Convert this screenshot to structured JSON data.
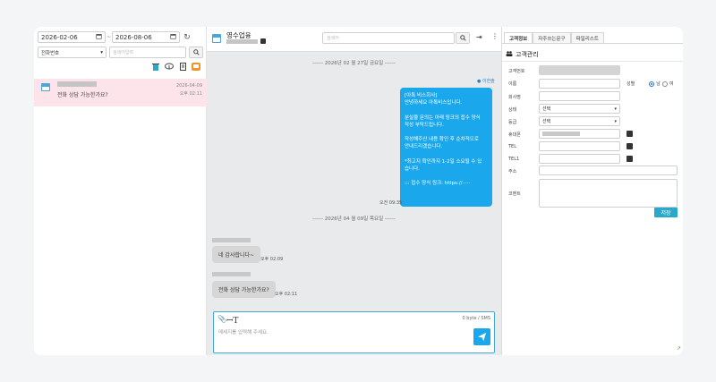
{
  "filters": {
    "start_date": "2026-02-06",
    "end_date": "2026-08-06",
    "separator": "~",
    "search_type": "전화번호",
    "search_placeholder": "검색어입력"
  },
  "chat_list": [
    {
      "preview": "전화 상담 가능한가요?",
      "date": "2026-04-09",
      "time": "오후 02:11"
    }
  ],
  "conversation": {
    "title": "영수업융",
    "search_placeholder": "검색어",
    "date_divider_1": "------ 2026년 02 월 27일 금요일 ------",
    "date_divider_2": "------ 2026년 04 월 09일 목요일 ------",
    "my_name": "이한솔",
    "my_message_lines": [
      "[아톡 비스회사]",
      "안녕하세요 아톡비스입니다.",
      "",
      "분실물 문의는 아래 링크의 접수 양식",
      "작성 부탁드립니다.",
      "",
      "작성해주신 내용 확인 후 순차적으로",
      "안내드리겠습니다.",
      "",
      "*최고지 확인까지 1-2일 소요될 수 있",
      "습니다.",
      "",
      "::: 접수 양식 링크: https://·····"
    ],
    "my_message_time": "오전 09:35",
    "incoming": [
      {
        "text": "네 감사합니다~",
        "time": "오후 02:09"
      },
      {
        "text": "전화 상담 가능한가요?",
        "time": "오후 02:11"
      }
    ],
    "compose_placeholder": "메세지를 입력해 주세요.",
    "byte_counter": "0 byte / SMS"
  },
  "right_panel": {
    "tabs": [
      "고객정보",
      "자주쓰는문구",
      "파일리스트"
    ],
    "panel_title": "고객관리",
    "fields": {
      "customer_no": "고객번호",
      "name": "이름",
      "gender": "성별",
      "gender_male": "남",
      "gender_female": "여",
      "company": "회사명",
      "status": "상태",
      "status_value": "선택",
      "grade": "등급",
      "grade_value": "선택",
      "mobile": "휴대폰",
      "tel": "TEL",
      "tel1": "TEL1",
      "address": "주소",
      "comment": "코멘트"
    },
    "save_label": "저장"
  }
}
